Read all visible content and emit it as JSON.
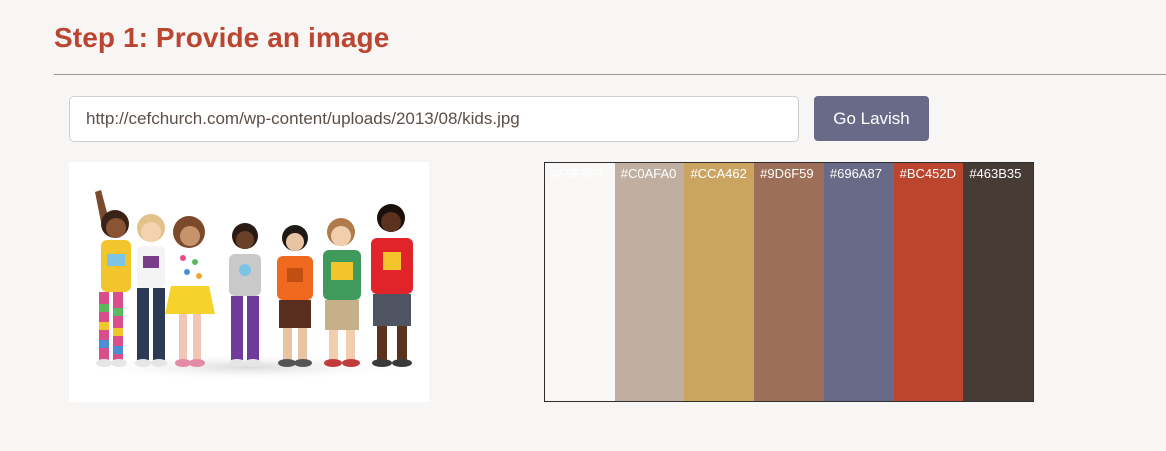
{
  "header": {
    "title": "Step 1: Provide an image"
  },
  "form": {
    "url_value": "http://cefchurch.com/wp-content/uploads/2013/08/kids.jpg",
    "button_label": "Go Lavish"
  },
  "image": {
    "alt": "kids.jpg"
  },
  "palette": [
    {
      "hex": "#F9F8F7",
      "label": "#F9F8F7"
    },
    {
      "hex": "#C0AFA0",
      "label": "#C0AFA0"
    },
    {
      "hex": "#CCA462",
      "label": "#CCA462"
    },
    {
      "hex": "#9D6F59",
      "label": "#9D6F59"
    },
    {
      "hex": "#696A87",
      "label": "#696A87"
    },
    {
      "hex": "#BC452D",
      "label": "#BC452D"
    },
    {
      "hex": "#463B35",
      "label": "#463B35"
    }
  ],
  "colors": {
    "accent": "#BB4530",
    "button": "#696A87",
    "background": "#F7F6F4"
  }
}
